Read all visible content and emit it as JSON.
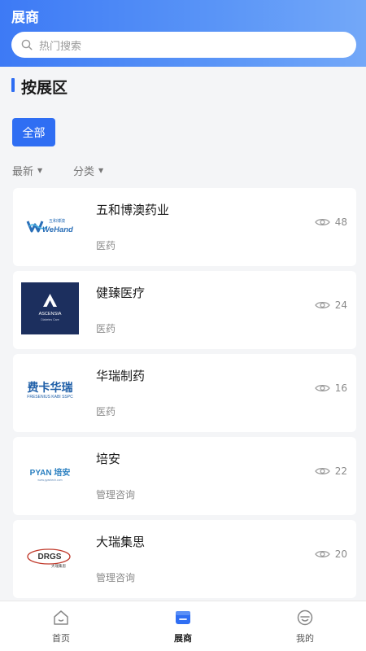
{
  "header": {
    "title": "展商"
  },
  "search": {
    "placeholder": "热门搜索"
  },
  "section": {
    "title": "按展区"
  },
  "filter_all": "全部",
  "filters": {
    "latest": "最新",
    "category": "分类"
  },
  "exhibitors": [
    {
      "name": "五和博澳药业",
      "category": "医药",
      "views": "48",
      "logo_text": "WeHand",
      "logo_sub": "五和博澳"
    },
    {
      "name": "健臻医疗",
      "category": "医药",
      "views": "24",
      "logo_text": "ASCENSIA",
      "logo_sub": "Diabetes Care"
    },
    {
      "name": "华瑞制药",
      "category": "医药",
      "views": "16",
      "logo_text": "费卡华瑞",
      "logo_sub": "FRESENIUS KABI SSPC"
    },
    {
      "name": "培安",
      "category": "管理咨询",
      "views": "22",
      "logo_text": "PYAN 培安",
      "logo_sub": "www.pyantech.com"
    },
    {
      "name": "大瑞集思",
      "category": "管理咨询",
      "views": "20",
      "logo_text": "DRGS",
      "logo_sub": "大瑞集思"
    }
  ],
  "tabs": {
    "home": "首页",
    "exhibitors": "展商",
    "mine": "我的"
  },
  "colors": {
    "accent": "#2f6ef3",
    "header_start": "#3d7af5",
    "header_end": "#73a8f8"
  }
}
